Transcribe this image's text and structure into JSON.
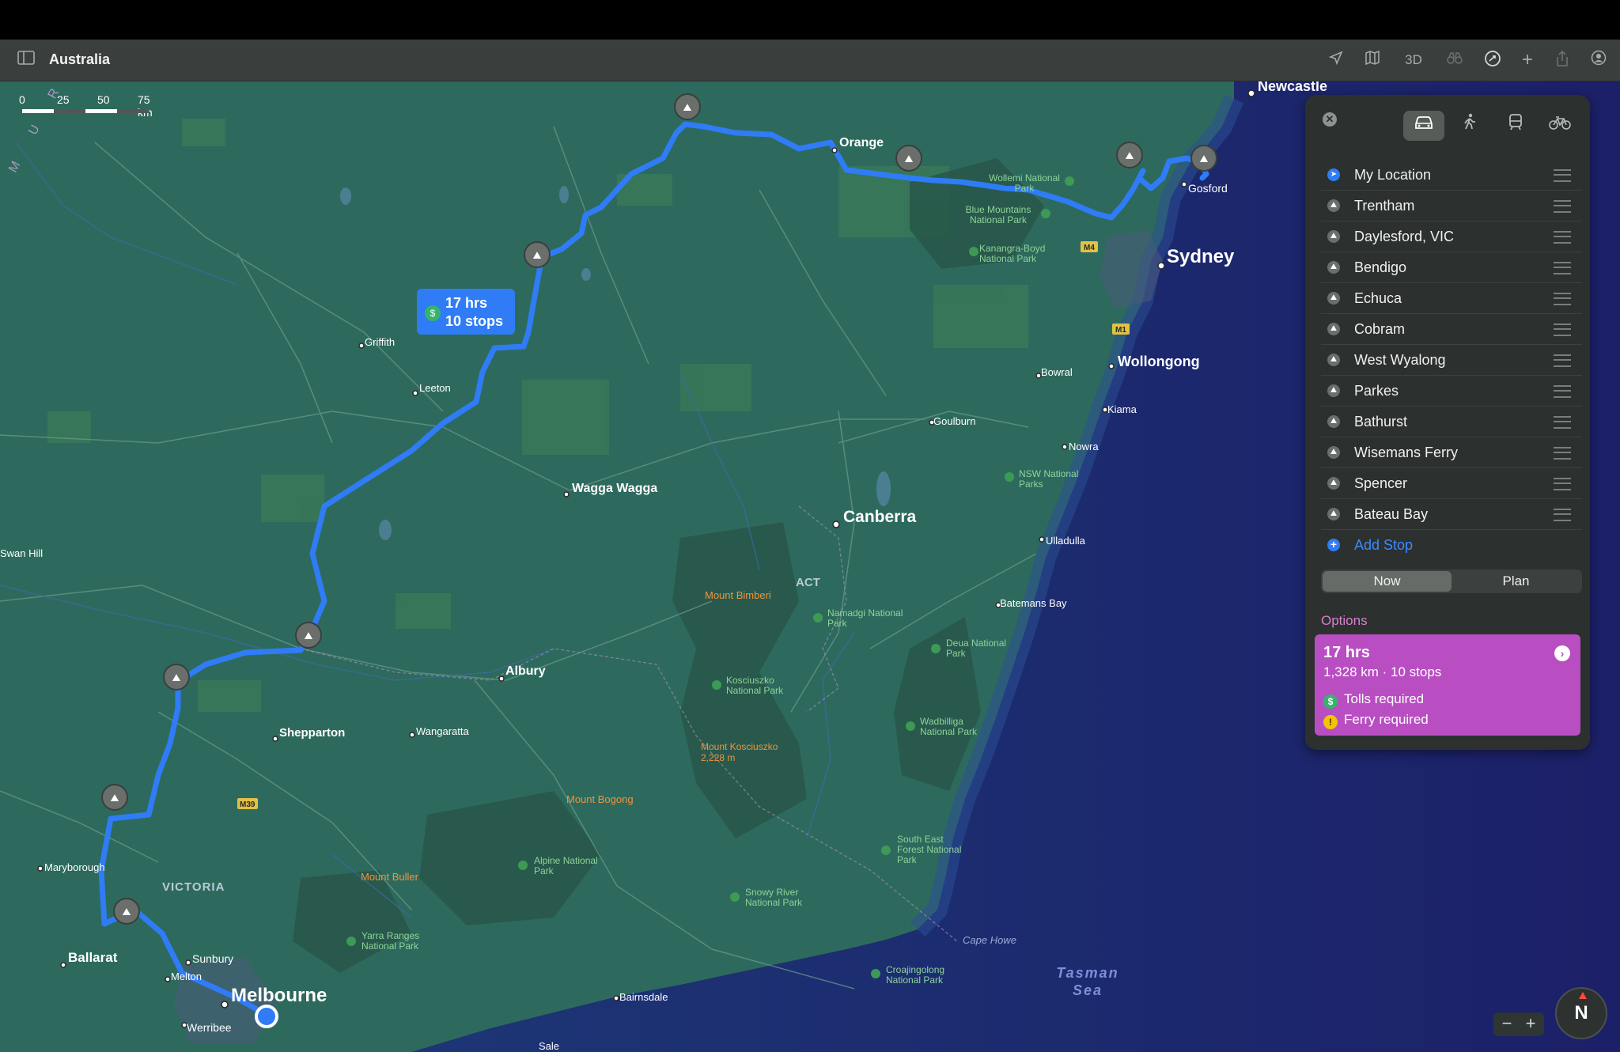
{
  "window": {
    "title": "Australia"
  },
  "toolbar": {
    "icons": [
      "sidebar-icon",
      "location-arrow-icon",
      "map-icon",
      "3d-label",
      "binoculars-icon",
      "route-icon",
      "plus-icon",
      "share-icon",
      "account-icon"
    ],
    "three_d_label": "3D"
  },
  "map": {
    "scale_labels": [
      "0",
      "25",
      "50",
      "75 km"
    ],
    "region_labels": {
      "state_victoria": "VICTORIA",
      "territory_act": "ACT",
      "sea": "Tasman Sea",
      "murray_label": "M U R R A"
    },
    "major_cities": {
      "sydney": "Sydney",
      "melbourne": "Melbourne",
      "canberra": "Canberra"
    },
    "cities": [
      {
        "name": "Newcastle"
      },
      {
        "name": "Gosford"
      },
      {
        "name": "Wollongong"
      },
      {
        "name": "Kiama"
      },
      {
        "name": "Bowral"
      },
      {
        "name": "Goulburn"
      },
      {
        "name": "Nowra"
      },
      {
        "name": "Ulladulla"
      },
      {
        "name": "Batemans Bay"
      },
      {
        "name": "Orange"
      },
      {
        "name": "Griffith"
      },
      {
        "name": "Leeton"
      },
      {
        "name": "Wagga Wagga"
      },
      {
        "name": "Swan Hill"
      },
      {
        "name": "Albury"
      },
      {
        "name": "Shepparton"
      },
      {
        "name": "Wangaratta"
      },
      {
        "name": "Maryborough"
      },
      {
        "name": "Ballarat"
      },
      {
        "name": "Sunbury"
      },
      {
        "name": "Melton"
      },
      {
        "name": "Werribee"
      },
      {
        "name": "Bairnsdale"
      },
      {
        "name": "Sale"
      }
    ],
    "parks": [
      "Wollemi National Park",
      "Blue Mountains National Park",
      "Kanangra-Boyd National Park",
      "NSW National Parks",
      "Namadgi National Park",
      "Deua National Park",
      "Kosciuszko National Park",
      "Wadbilliga National Park",
      "Alpine National Park",
      "Snowy River National Park",
      "South East Forest National Park",
      "Yarra Ranges National Park",
      "Croajingolong National Park"
    ],
    "mountains": [
      "Mount Bimberi",
      "Mount Kosciuszko 2,228 m",
      "Mount Bogong",
      "Mount Buller"
    ],
    "other_labels": [
      "Cape Howe"
    ],
    "road_shields": [
      "M4",
      "M1",
      "M39"
    ],
    "eta_bubble": {
      "time": "17 hrs",
      "stops": "10 stops",
      "icon": "toll-dollar-icon"
    }
  },
  "panel": {
    "modes": [
      "drive-icon",
      "walk-icon",
      "transit-icon",
      "cycle-icon"
    ],
    "active_mode": "drive-icon",
    "stops": [
      {
        "label": "My Location",
        "icon": "location-arrow-icon"
      },
      {
        "label": "Trentham",
        "icon": "park-icon"
      },
      {
        "label": "Daylesford, VIC",
        "icon": "park-icon"
      },
      {
        "label": "Bendigo",
        "icon": "park-icon"
      },
      {
        "label": "Echuca",
        "icon": "park-icon"
      },
      {
        "label": "Cobram",
        "icon": "park-icon"
      },
      {
        "label": "West Wyalong",
        "icon": "park-icon"
      },
      {
        "label": "Parkes",
        "icon": "park-icon"
      },
      {
        "label": "Bathurst",
        "icon": "park-icon"
      },
      {
        "label": "Wisemans Ferry",
        "icon": "park-icon"
      },
      {
        "label": "Spencer",
        "icon": "park-icon"
      },
      {
        "label": "Bateau Bay",
        "icon": "park-icon"
      }
    ],
    "add_stop": "Add Stop",
    "time_toggle": {
      "now": "Now",
      "plan": "Plan",
      "selected": "Now"
    },
    "options_label": "Options",
    "route": {
      "time": "17 hrs",
      "summary": "1,328 km · 10 stops",
      "notes": [
        "Tolls required",
        "Ferry required"
      ],
      "color": "#b84ec1"
    }
  },
  "controls": {
    "zoom_out": "−",
    "zoom_in": "+",
    "compass": "N"
  },
  "colors": {
    "route": "#2f7cf6",
    "land": "#2e6b5c",
    "ocean": "#1f2f78",
    "panel": "#2c302e"
  }
}
